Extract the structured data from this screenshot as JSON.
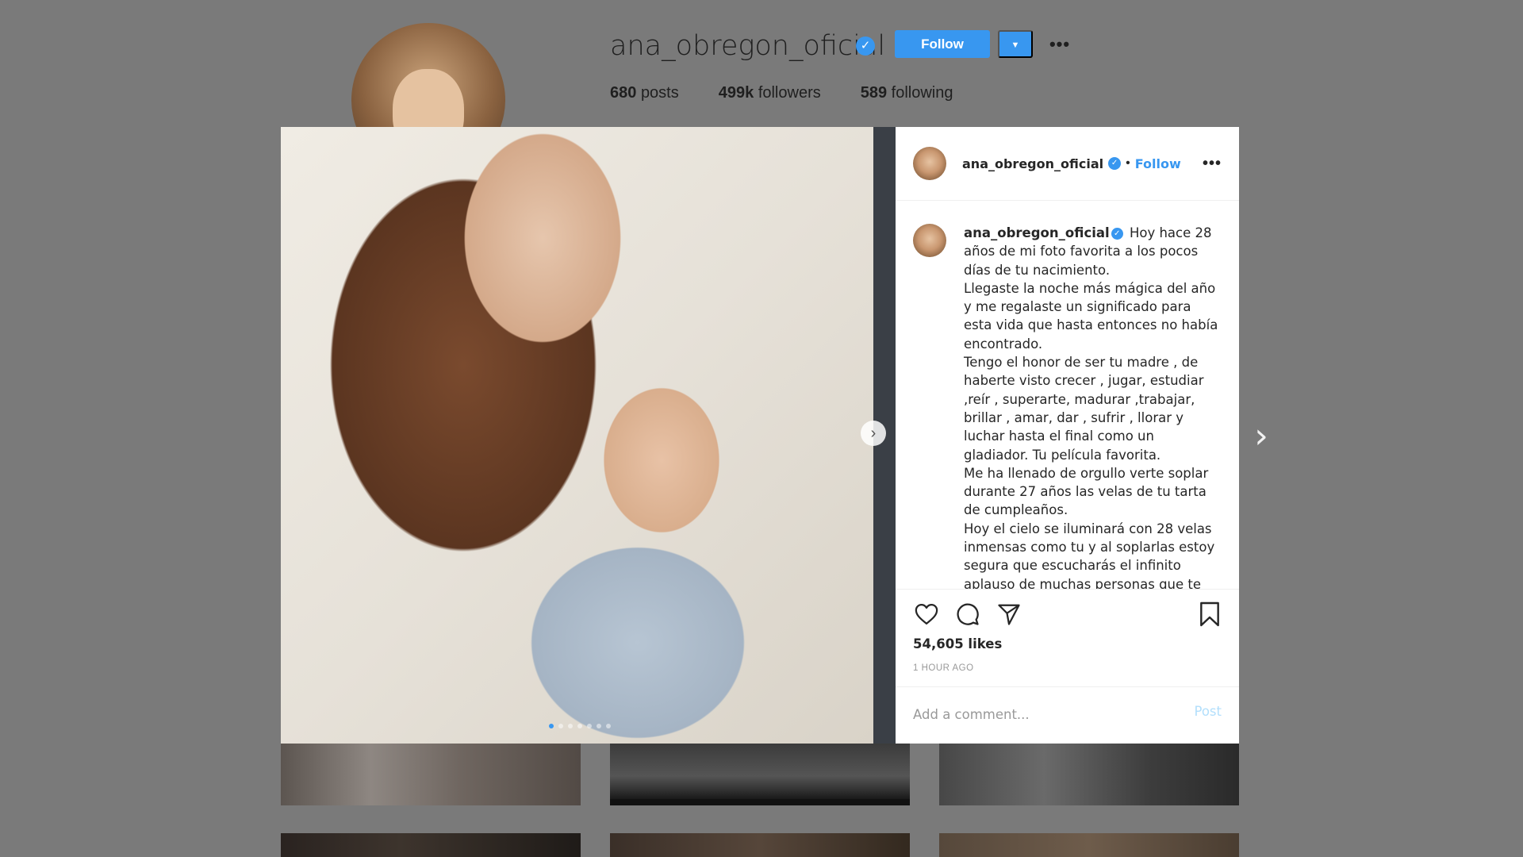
{
  "profile": {
    "username": "ana_obregon_oficial",
    "verified_mark": "✓",
    "follow_label": "Follow",
    "dropdown_icon": "▼",
    "more_icon": "•••",
    "stats": {
      "posts_count": "680",
      "posts_label": "posts",
      "followers_count": "499k",
      "followers_label": "followers",
      "following_count": "589",
      "following_label": "following"
    }
  },
  "post": {
    "header": {
      "username": "ana_obregon_oficial",
      "verified_mark": "✓",
      "separator": "•",
      "follow_label": "Follow",
      "more_icon": "•••"
    },
    "caption": {
      "username": "ana_obregon_oficial",
      "verified_mark": "✓",
      "text": "Hoy hace 28\naños de mi foto favorita a los pocos\ndías de tu nacimiento.\nLlegaste la noche más mágica del año\ny me regalaste un significado para\nesta vida que hasta entonces no había\nencontrado.\nTengo el honor de ser tu madre , de\nhaberte visto crecer , jugar, estudiar\n,reír , superarte, madurar ,trabajar,\nbrillar , amar, dar , sufrir , llorar y\nluchar hasta el final como un\ngladiador. Tu película favorita.\nMe ha llenado de orgullo verte soplar\ndurante 27 años las velas de tu tarta\nde cumpleaños.\nHoy el cielo se iluminará con 28 velas\ninmensas como tu y al soplarlas estoy\nsegura que escucharás el infinito\naplauso de muchas personas que te"
    },
    "likes": "54,605 likes",
    "time_ago": "1 HOUR AGO",
    "comment_placeholder": "Add a comment...",
    "post_label": "Post",
    "carousel_next_icon": "›",
    "carousel": {
      "total": 7,
      "active_index": 0
    }
  },
  "navigation": {
    "next_post_icon": "›"
  },
  "icons": [
    "heart-icon",
    "comment-icon",
    "share-icon",
    "bookmark-icon"
  ],
  "colors": {
    "accent": "#3897f0",
    "post_disabled": "#b2dffc",
    "overlay": "#7a7a7a"
  }
}
